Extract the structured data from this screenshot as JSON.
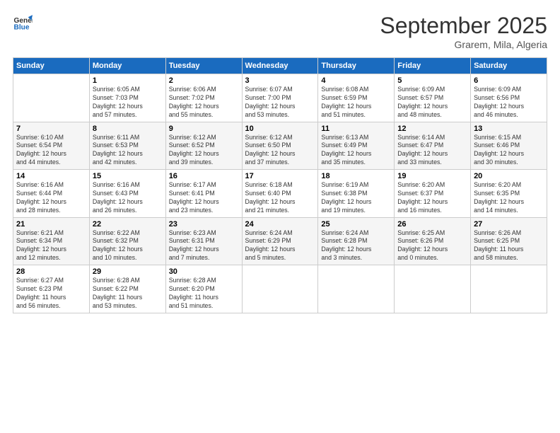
{
  "logo": {
    "line1": "General",
    "line2": "Blue"
  },
  "header": {
    "month": "September 2025",
    "location": "Grarem, Mila, Algeria"
  },
  "weekdays": [
    "Sunday",
    "Monday",
    "Tuesday",
    "Wednesday",
    "Thursday",
    "Friday",
    "Saturday"
  ],
  "weeks": [
    [
      {
        "day": "",
        "info": ""
      },
      {
        "day": "1",
        "info": "Sunrise: 6:05 AM\nSunset: 7:03 PM\nDaylight: 12 hours\nand 57 minutes."
      },
      {
        "day": "2",
        "info": "Sunrise: 6:06 AM\nSunset: 7:02 PM\nDaylight: 12 hours\nand 55 minutes."
      },
      {
        "day": "3",
        "info": "Sunrise: 6:07 AM\nSunset: 7:00 PM\nDaylight: 12 hours\nand 53 minutes."
      },
      {
        "day": "4",
        "info": "Sunrise: 6:08 AM\nSunset: 6:59 PM\nDaylight: 12 hours\nand 51 minutes."
      },
      {
        "day": "5",
        "info": "Sunrise: 6:09 AM\nSunset: 6:57 PM\nDaylight: 12 hours\nand 48 minutes."
      },
      {
        "day": "6",
        "info": "Sunrise: 6:09 AM\nSunset: 6:56 PM\nDaylight: 12 hours\nand 46 minutes."
      }
    ],
    [
      {
        "day": "7",
        "info": "Sunrise: 6:10 AM\nSunset: 6:54 PM\nDaylight: 12 hours\nand 44 minutes."
      },
      {
        "day": "8",
        "info": "Sunrise: 6:11 AM\nSunset: 6:53 PM\nDaylight: 12 hours\nand 42 minutes."
      },
      {
        "day": "9",
        "info": "Sunrise: 6:12 AM\nSunset: 6:52 PM\nDaylight: 12 hours\nand 39 minutes."
      },
      {
        "day": "10",
        "info": "Sunrise: 6:12 AM\nSunset: 6:50 PM\nDaylight: 12 hours\nand 37 minutes."
      },
      {
        "day": "11",
        "info": "Sunrise: 6:13 AM\nSunset: 6:49 PM\nDaylight: 12 hours\nand 35 minutes."
      },
      {
        "day": "12",
        "info": "Sunrise: 6:14 AM\nSunset: 6:47 PM\nDaylight: 12 hours\nand 33 minutes."
      },
      {
        "day": "13",
        "info": "Sunrise: 6:15 AM\nSunset: 6:46 PM\nDaylight: 12 hours\nand 30 minutes."
      }
    ],
    [
      {
        "day": "14",
        "info": "Sunrise: 6:16 AM\nSunset: 6:44 PM\nDaylight: 12 hours\nand 28 minutes."
      },
      {
        "day": "15",
        "info": "Sunrise: 6:16 AM\nSunset: 6:43 PM\nDaylight: 12 hours\nand 26 minutes."
      },
      {
        "day": "16",
        "info": "Sunrise: 6:17 AM\nSunset: 6:41 PM\nDaylight: 12 hours\nand 23 minutes."
      },
      {
        "day": "17",
        "info": "Sunrise: 6:18 AM\nSunset: 6:40 PM\nDaylight: 12 hours\nand 21 minutes."
      },
      {
        "day": "18",
        "info": "Sunrise: 6:19 AM\nSunset: 6:38 PM\nDaylight: 12 hours\nand 19 minutes."
      },
      {
        "day": "19",
        "info": "Sunrise: 6:20 AM\nSunset: 6:37 PM\nDaylight: 12 hours\nand 16 minutes."
      },
      {
        "day": "20",
        "info": "Sunrise: 6:20 AM\nSunset: 6:35 PM\nDaylight: 12 hours\nand 14 minutes."
      }
    ],
    [
      {
        "day": "21",
        "info": "Sunrise: 6:21 AM\nSunset: 6:34 PM\nDaylight: 12 hours\nand 12 minutes."
      },
      {
        "day": "22",
        "info": "Sunrise: 6:22 AM\nSunset: 6:32 PM\nDaylight: 12 hours\nand 10 minutes."
      },
      {
        "day": "23",
        "info": "Sunrise: 6:23 AM\nSunset: 6:31 PM\nDaylight: 12 hours\nand 7 minutes."
      },
      {
        "day": "24",
        "info": "Sunrise: 6:24 AM\nSunset: 6:29 PM\nDaylight: 12 hours\nand 5 minutes."
      },
      {
        "day": "25",
        "info": "Sunrise: 6:24 AM\nSunset: 6:28 PM\nDaylight: 12 hours\nand 3 minutes."
      },
      {
        "day": "26",
        "info": "Sunrise: 6:25 AM\nSunset: 6:26 PM\nDaylight: 12 hours\nand 0 minutes."
      },
      {
        "day": "27",
        "info": "Sunrise: 6:26 AM\nSunset: 6:25 PM\nDaylight: 11 hours\nand 58 minutes."
      }
    ],
    [
      {
        "day": "28",
        "info": "Sunrise: 6:27 AM\nSunset: 6:23 PM\nDaylight: 11 hours\nand 56 minutes."
      },
      {
        "day": "29",
        "info": "Sunrise: 6:28 AM\nSunset: 6:22 PM\nDaylight: 11 hours\nand 53 minutes."
      },
      {
        "day": "30",
        "info": "Sunrise: 6:28 AM\nSunset: 6:20 PM\nDaylight: 11 hours\nand 51 minutes."
      },
      {
        "day": "",
        "info": ""
      },
      {
        "day": "",
        "info": ""
      },
      {
        "day": "",
        "info": ""
      },
      {
        "day": "",
        "info": ""
      }
    ]
  ]
}
